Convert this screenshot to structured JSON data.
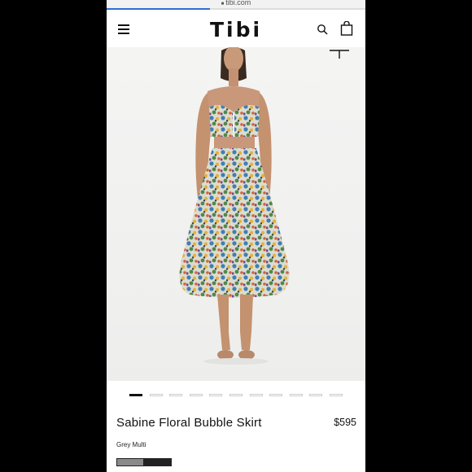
{
  "browser": {
    "url": "tibi.com",
    "load_progress": 0.4
  },
  "header": {
    "logo": "Tibi",
    "icons": {
      "menu": "menu-icon",
      "search": "search-icon",
      "bag": "shopping-bag-icon"
    }
  },
  "gallery": {
    "image": "model wearing floral bralette top and matching floral bubble skirt",
    "total_images": 11,
    "active_index": 0
  },
  "product": {
    "title": "Sabine Floral Bubble Skirt",
    "price": "$595",
    "color": "Grey Multi",
    "swatches": [
      "#8a8a8a",
      "#222222"
    ]
  }
}
